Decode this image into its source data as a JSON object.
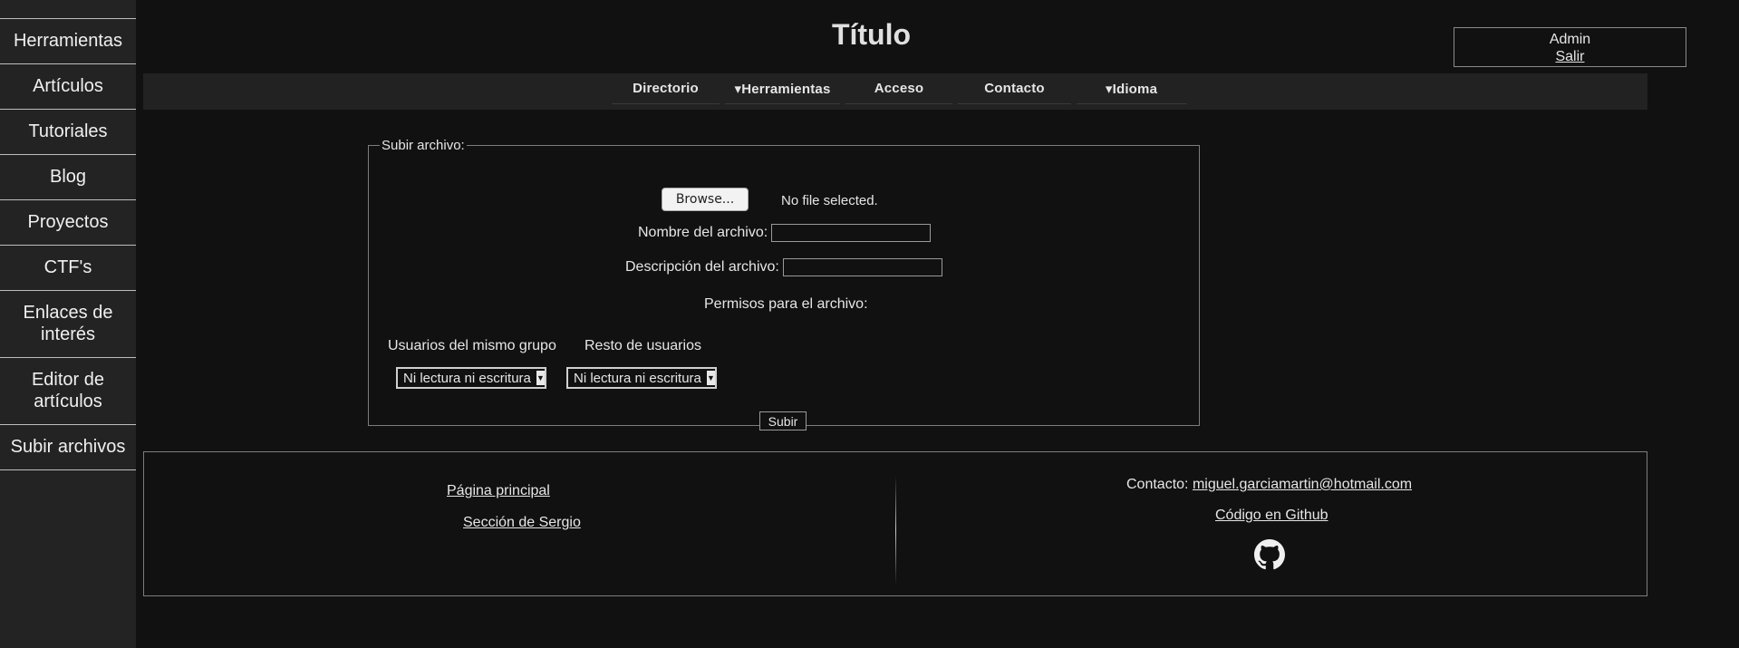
{
  "sidebar": {
    "items": [
      {
        "label": "Herramientas"
      },
      {
        "label": "Artículos"
      },
      {
        "label": "Tutoriales"
      },
      {
        "label": "Blog"
      },
      {
        "label": "Proyectos"
      },
      {
        "label": "CTF's"
      },
      {
        "label": "Enlaces de interés"
      },
      {
        "label": "Editor de artículos"
      },
      {
        "label": "Subir archivos"
      }
    ]
  },
  "header": {
    "title": "Título",
    "user": {
      "name": "Admin",
      "logout": "Salir"
    }
  },
  "nav": {
    "items": [
      {
        "label": "Directorio"
      },
      {
        "label": "▾Herramientas"
      },
      {
        "label": "Acceso"
      },
      {
        "label": "Contacto"
      },
      {
        "label": "▾Idioma"
      }
    ]
  },
  "upload": {
    "legend": "Subir archivo:",
    "browse_label": "Browse...",
    "no_file_text": "No file selected.",
    "filename_label": "Nombre del archivo:",
    "description_label": "Descripción del archivo:",
    "permissions_label": "Permisos para el archivo:",
    "group_label": "Usuarios del mismo grupo",
    "others_label": "Resto de usuarios",
    "group_select_value": "Ni lectura ni escritura",
    "others_select_value": "Ni lectura ni escritura",
    "submit_label": "Subir"
  },
  "footer": {
    "home_link": "Página principal",
    "sergio_link": "Sección de Sergio",
    "contact_label": "Contacto:",
    "contact_email": "miguel.garciamartin@hotmail.com",
    "github_link": "Código en Github",
    "github_icon": "github-icon"
  }
}
